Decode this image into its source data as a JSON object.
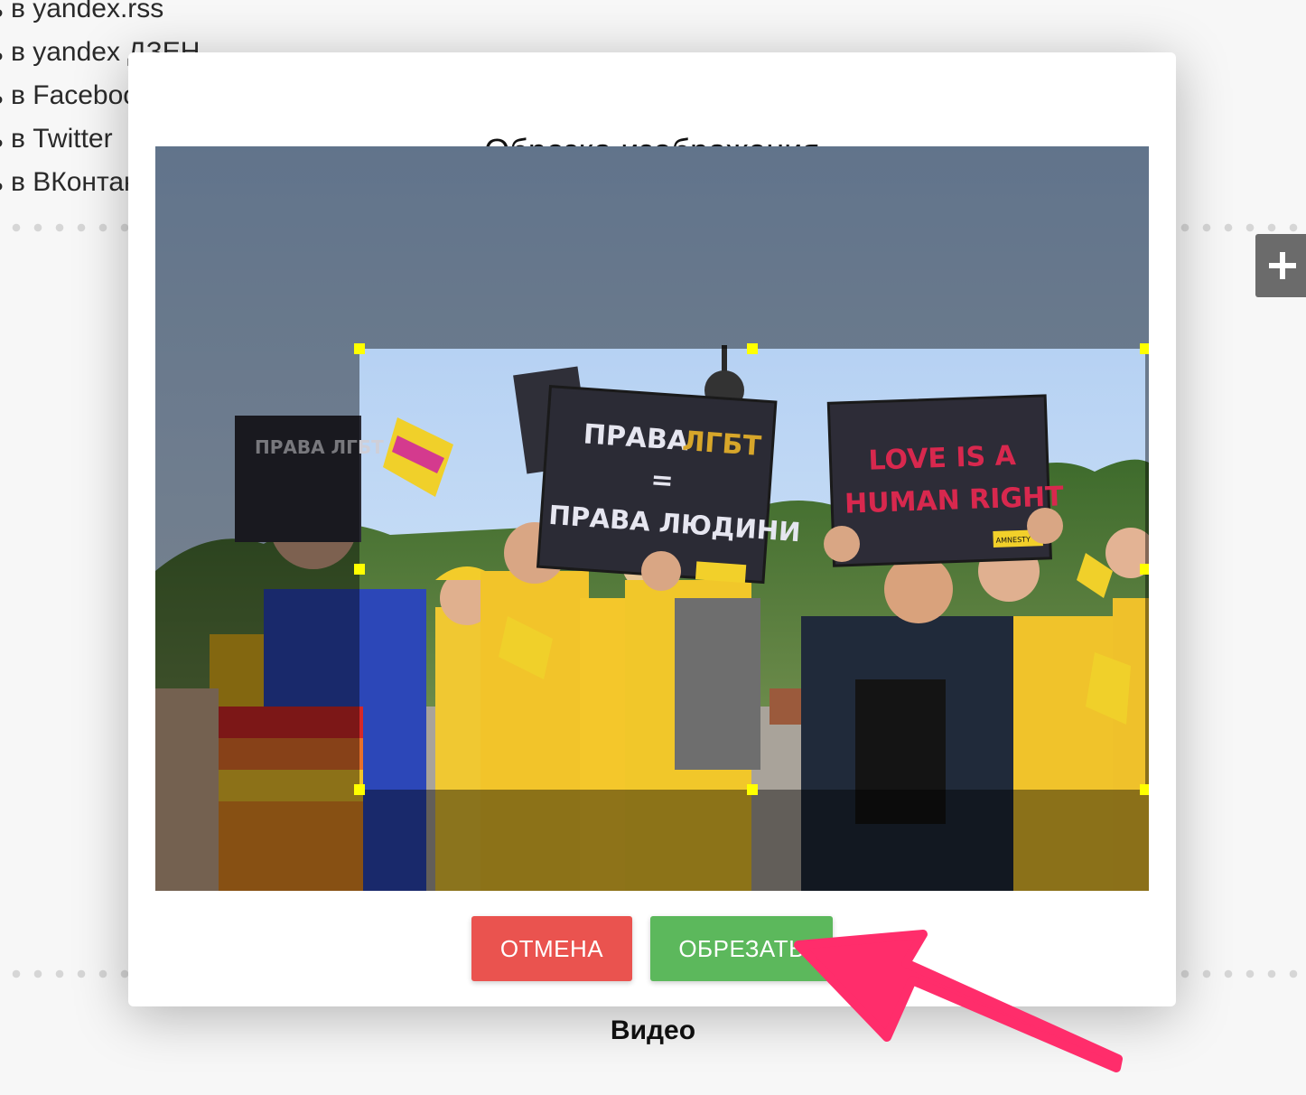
{
  "background": {
    "links": [
      "ь в yandex.rss",
      "ь в yandex ДЗЕН",
      "ь в Facebook",
      "ь в Twitter",
      "ь в ВКонтакте"
    ],
    "caption": "Видео",
    "add_icon": "plus-icon"
  },
  "modal": {
    "title": "Обрезка изображения",
    "cancel_label": "ОТМЕНА",
    "crop_label": "ОБРЕЗАТЬ",
    "colors": {
      "cancel": "#ea534f",
      "crop": "#5cb85c",
      "handle": "#ffff00",
      "arrow": "#ff2d6b"
    }
  },
  "photo": {
    "sign_left": "ПРАВА ЛГБТ = ПРАВА ЛЮДИНИ",
    "sign_left_line1a": "ПРАВА",
    "sign_left_line1b": "ЛГБТ",
    "sign_left_line2": "=",
    "sign_left_line3": "ПРАВА ЛЮДИНИ",
    "sign_right_line1": "LOVE IS A",
    "sign_right_line2": "HUMAN RIGHT",
    "sign_small": "AMNESTY",
    "sign_back_left": "ПРАВА ЛГБТ"
  }
}
